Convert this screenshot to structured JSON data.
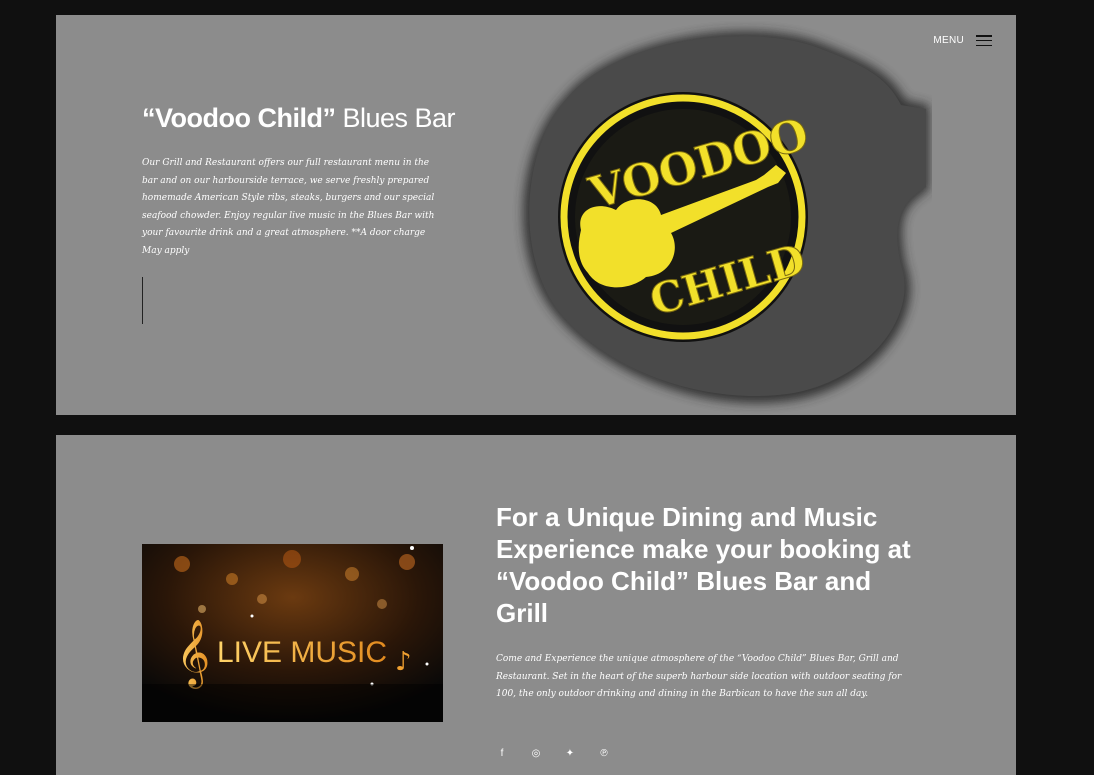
{
  "nav": {
    "menu_label": "MENU"
  },
  "hero": {
    "title_bold": "“Voodoo Child”",
    "title_light": " Blues Bar",
    "description": "Our Grill and Restaurant offers our full restaurant menu in the bar and on our harbourside terrace, we serve freshly prepared homemade American Style ribs, steaks, burgers and our special seafood chowder. Enjoy regular live music in the Blues Bar with your favourite drink and a great atmosphere. **A door charge May apply",
    "logo_top_text": "VOODOO",
    "logo_bottom_text": "CHILD"
  },
  "booking": {
    "image_text": "LIVE MUSIC",
    "headline": "For a Unique Dining and Music Experience make your booking at “Voodoo Child” Blues Bar and Grill",
    "body": "Come and Experience the unique atmosphere of the “Voodoo Child” Blues Bar, Grill and Restaurant. Set in the heart of the superb harbour side location with outdoor seating for 100, the only outdoor drinking and dining in the Barbican to have the sun all day."
  },
  "social": [
    {
      "icon": "facebook-icon",
      "glyph": "f"
    },
    {
      "icon": "instagram-icon",
      "glyph": "◎"
    },
    {
      "icon": "twitter-icon",
      "glyph": "✦"
    },
    {
      "icon": "pinterest-icon",
      "glyph": "℗"
    }
  ],
  "colors": {
    "page_bg": "#101010",
    "panel_bg": "#8c8c8c",
    "logo_yellow": "#f2e02a",
    "guitar_dark": "#4a4a4a"
  }
}
